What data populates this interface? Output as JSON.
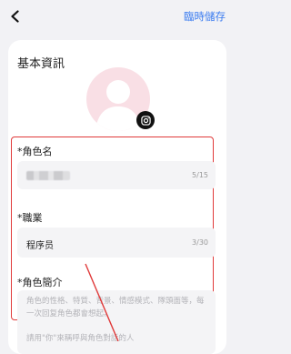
{
  "header": {
    "save_label": "臨時儲存"
  },
  "basic_info": {
    "title": "基本資訊",
    "fields": [
      {
        "label": "*角色名",
        "value": "",
        "counter": "5/15"
      },
      {
        "label": "*職業",
        "value": "程序员",
        "counter": "3/30"
      },
      {
        "label": "*角色簡介",
        "placeholder": "角色的性格、特質、背景、情感模式、隊頭面等，每一次回复角色都會想起。",
        "hint": "請用\"你\"來稱呼與角色對話的人"
      }
    ]
  },
  "colors": {
    "accent": "#3b7cf0",
    "highlight": "#e03a3a",
    "avatar_bg": "#f9dfe5"
  },
  "icons": [
    "back-chevron-icon",
    "instagram-icon",
    "avatar-placeholder-icon"
  ]
}
